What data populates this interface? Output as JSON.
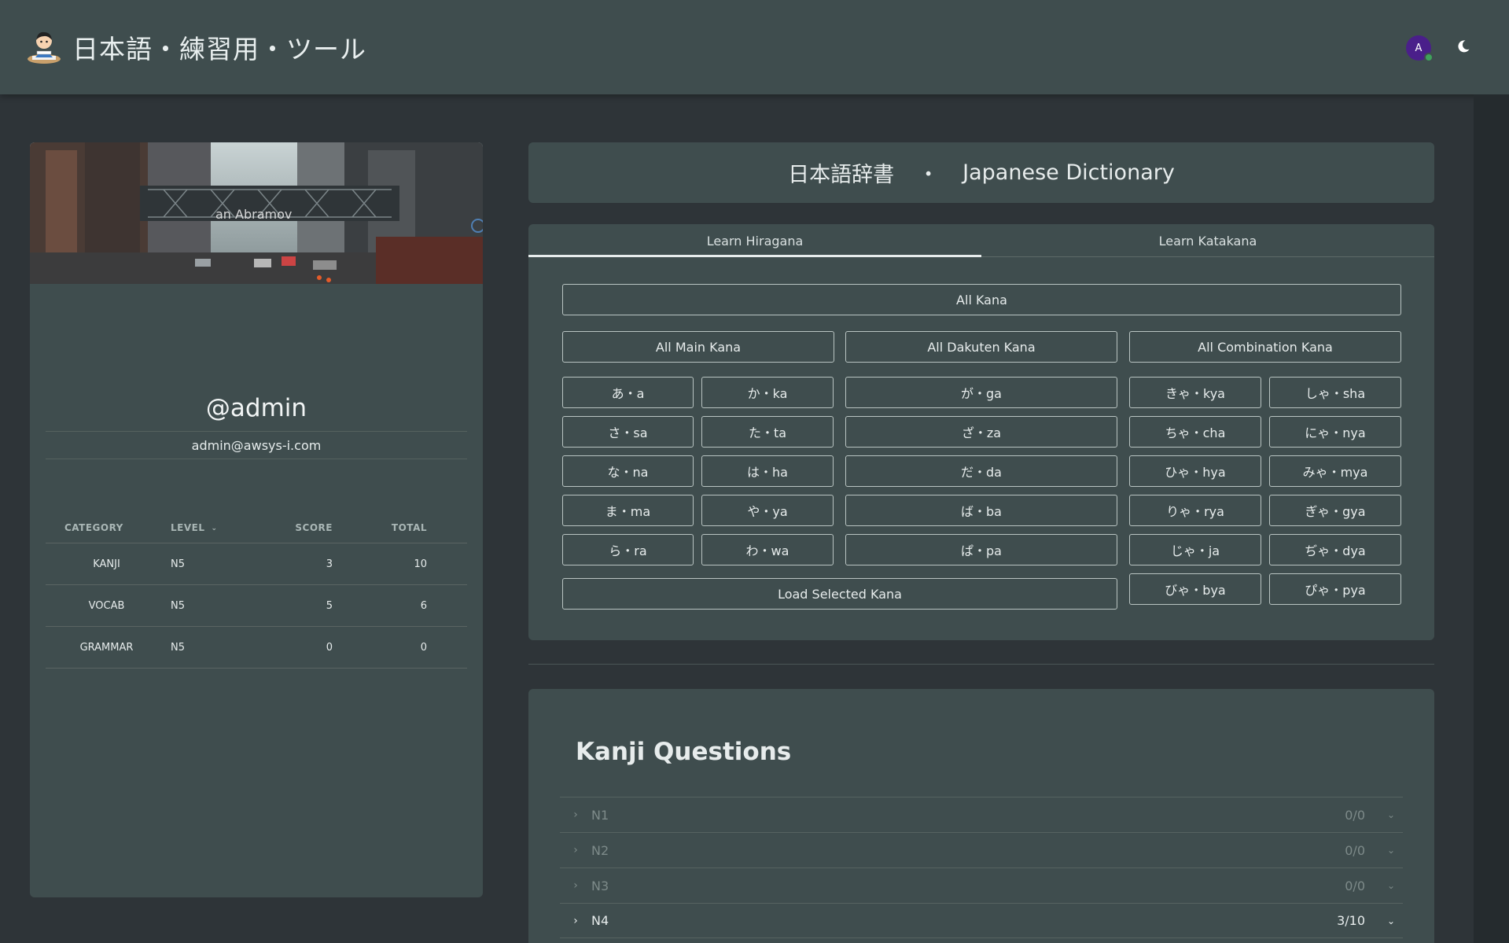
{
  "header": {
    "app_title": "日本語・練習用・ツール",
    "avatar_initial": "A"
  },
  "profile": {
    "cover_name": "an Abramov",
    "username": "@admin",
    "email": "admin@awsys-i.com",
    "table": {
      "headers": [
        "CATEGORY",
        "LEVEL",
        "SCORE",
        "TOTAL"
      ],
      "rows": [
        {
          "category": "KANJI",
          "level": "N5",
          "score": "3",
          "total": "10"
        },
        {
          "category": "VOCAB",
          "level": "N5",
          "score": "5",
          "total": "6"
        },
        {
          "category": "GRAMMAR",
          "level": "N5",
          "score": "0",
          "total": "0"
        }
      ]
    }
  },
  "dictionary": {
    "title_jp": "日本語辞書",
    "separator": "・",
    "title_en": "Japanese Dictionary"
  },
  "kana": {
    "tabs": [
      "Learn Hiragana",
      "Learn Katakana"
    ],
    "all_kana": "All Kana",
    "groups": [
      "All Main Kana",
      "All Dakuten Kana",
      "All Combination Kana"
    ],
    "main": [
      "あ・a",
      "か・ka",
      "さ・sa",
      "た・ta",
      "な・na",
      "は・ha",
      "ま・ma",
      "や・ya",
      "ら・ra",
      "わ・wa"
    ],
    "dakuten": [
      "が・ga",
      "ざ・za",
      "だ・da",
      "ば・ba",
      "ぱ・pa"
    ],
    "combination": [
      "きゃ・kya",
      "しゃ・sha",
      "ちゃ・cha",
      "にゃ・nya",
      "ひゃ・hya",
      "みゃ・mya",
      "りゃ・rya",
      "ぎゃ・gya",
      "じゃ・ja",
      "ぢゃ・dya",
      "びゃ・bya",
      "ぴゃ・pya"
    ],
    "load_selected": "Load Selected Kana"
  },
  "kanji": {
    "title": "Kanji Questions",
    "levels": [
      {
        "label": "N1",
        "count": "0/0"
      },
      {
        "label": "N2",
        "count": "0/0"
      },
      {
        "label": "N3",
        "count": "0/0"
      },
      {
        "label": "N4",
        "count": "3/10"
      }
    ]
  },
  "icons": {
    "logo": "student-studying-icon",
    "theme": "moon-icon",
    "expand": "chevron-right-icon",
    "collapse": "chevron-down-icon"
  },
  "colors": {
    "background": "#2e3438",
    "card": "#3f4d4e",
    "avatar": "#4a1f8a",
    "status_online": "#3fa25b"
  }
}
